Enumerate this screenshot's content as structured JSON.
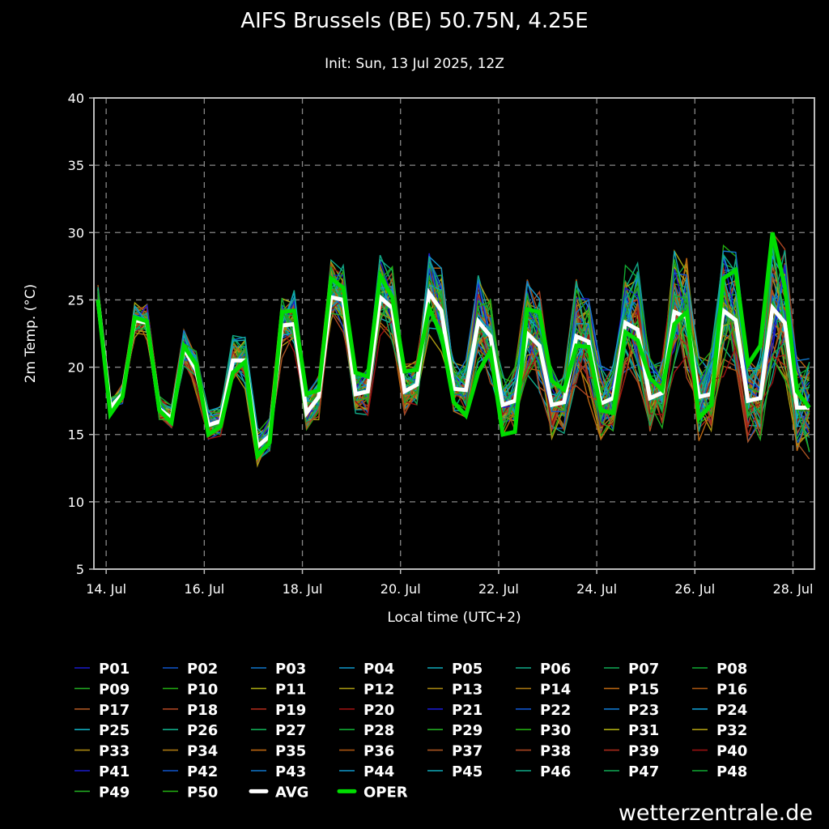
{
  "chart_data": {
    "type": "line",
    "title": "AIFS Brussels (BE) 50.75N, 4.25E",
    "subtitle": "Init: Sun, 13 Jul 2025, 12Z",
    "xlabel": "Local time (UTC+2)",
    "ylabel": "2m Temp. (°C)",
    "ylim": [
      5,
      40
    ],
    "yticks": [
      40,
      35,
      30,
      25,
      20,
      15,
      10,
      5
    ],
    "x_units": "hours since 14 Jul 00:00 local",
    "xlim": [
      -6,
      346.5
    ],
    "x_start": -4,
    "x_step": 6,
    "xticks": [
      {
        "x": 0,
        "label": "14. Jul"
      },
      {
        "x": 48,
        "label": "16. Jul"
      },
      {
        "x": 96,
        "label": "18. Jul"
      },
      {
        "x": 144,
        "label": "20. Jul"
      },
      {
        "x": 192,
        "label": "22. Jul"
      },
      {
        "x": 240,
        "label": "24. Jul"
      },
      {
        "x": 288,
        "label": "26. Jul"
      },
      {
        "x": 336,
        "label": "28. Jul"
      }
    ],
    "grid": true,
    "legend_placement": "bottom",
    "series_avg": {
      "name": "AVG",
      "color": "#ffffff",
      "values": [
        25.0,
        17.0,
        18.0,
        23.5,
        23.3,
        16.9,
        16.2,
        21.4,
        19.8,
        15.7,
        16.0,
        20.5,
        20.5,
        14.1,
        14.9,
        23.1,
        23.2,
        16.6,
        17.8,
        25.2,
        25.0,
        18.0,
        18.2,
        25.2,
        24.4,
        18.2,
        18.7,
        25.5,
        24.2,
        18.4,
        18.3,
        23.4,
        22.3,
        17.2,
        17.5,
        22.5,
        21.6,
        17.2,
        17.4,
        22.3,
        21.9,
        17.3,
        17.7,
        23.3,
        22.8,
        17.7,
        18.1,
        24.1,
        23.7,
        17.8,
        18.0,
        24.2,
        23.5,
        17.5,
        17.7,
        24.4,
        23.3,
        17.0,
        17.0
      ]
    },
    "series_oper": {
      "name": "OPER",
      "color": "#00dd00",
      "values": [
        25.0,
        16.5,
        17.8,
        23.7,
        23.4,
        16.8,
        15.9,
        21.6,
        20.2,
        15.0,
        15.6,
        19.6,
        20.4,
        13.4,
        14.4,
        24.1,
        24.2,
        18.0,
        18.3,
        26.6,
        25.9,
        19.6,
        19.3,
        26.8,
        25.2,
        19.7,
        19.8,
        24.4,
        22.4,
        17.4,
        16.4,
        19.6,
        21.2,
        15.0,
        15.2,
        24.3,
        24.1,
        19.0,
        18.3,
        21.6,
        21.5,
        16.8,
        16.6,
        22.6,
        22.0,
        19.2,
        18.3,
        23.2,
        24.1,
        16.2,
        17.2,
        26.6,
        27.2,
        20.2,
        21.6,
        30.0,
        26.0,
        18.2,
        17.0
      ]
    },
    "member_palette": [
      "#1a1acc",
      "#1155cc",
      "#1177cc",
      "#1199cc",
      "#11aabb",
      "#11aa88",
      "#11aa55",
      "#11aa33",
      "#22aa22",
      "#22aa11",
      "#aaaa11",
      "#aa9911",
      "#aa8811",
      "#aa7711",
      "#bb6611",
      "#aa5511",
      "#aa5522",
      "#aa4422",
      "#aa2a1a",
      "#991111"
    ],
    "members": [
      "P01",
      "P02",
      "P03",
      "P04",
      "P05",
      "P06",
      "P07",
      "P08",
      "P09",
      "P10",
      "P11",
      "P12",
      "P13",
      "P14",
      "P15",
      "P16",
      "P17",
      "P18",
      "P19",
      "P20",
      "P21",
      "P22",
      "P23",
      "P24",
      "P25",
      "P26",
      "P27",
      "P28",
      "P29",
      "P30",
      "P31",
      "P32",
      "P33",
      "P34",
      "P35",
      "P36",
      "P37",
      "P38",
      "P39",
      "P40",
      "P41",
      "P42",
      "P43",
      "P44",
      "P45",
      "P46",
      "P47",
      "P48",
      "P49",
      "P50"
    ]
  },
  "watermark": "wetterzentrale.de"
}
